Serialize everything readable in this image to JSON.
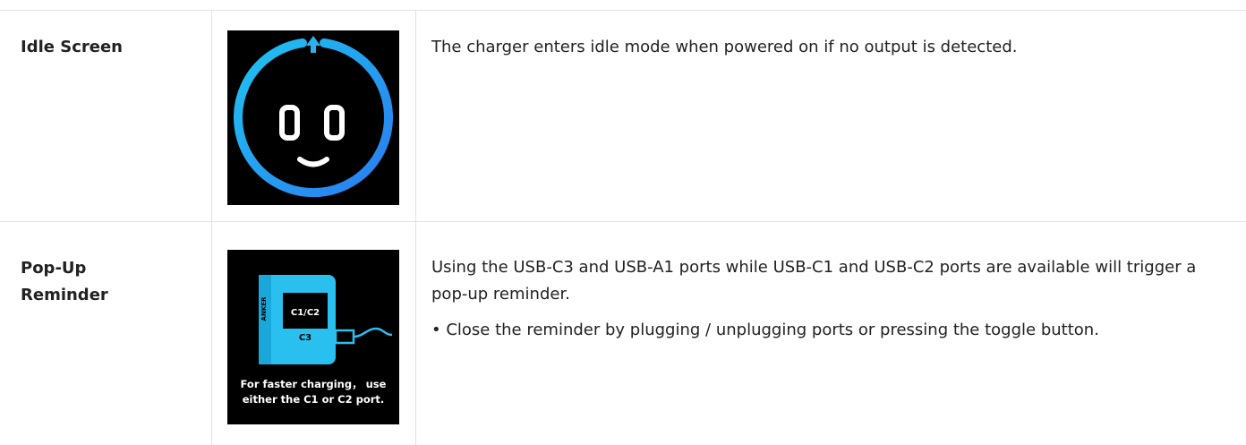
{
  "rows": [
    {
      "label": "Idle Screen",
      "image": {
        "icon": "smiling-face-ring-icon",
        "ring_colors": [
          "#1fc3f0",
          "#2a7cf0"
        ]
      },
      "paragraphs": [
        "The charger enters idle mode when powered on if no output is detected."
      ]
    },
    {
      "label": "Pop-Up Reminder",
      "image": {
        "icon": "charger-port-icon",
        "brand": "ANKER",
        "port_top": "C1/C2",
        "port_bottom": "C3",
        "caption_line1": "For faster charging， use",
        "caption_line2": "either the C1 or C2 port.",
        "accent": "#29c0ef"
      },
      "paragraphs": [
        "Using the USB-C3 and USB-A1 ports while USB-C1 and USB-C2 ports are available will trigger a pop-up reminder.",
        "• Close the reminder by plugging / unplugging ports or pressing the toggle button."
      ]
    }
  ]
}
